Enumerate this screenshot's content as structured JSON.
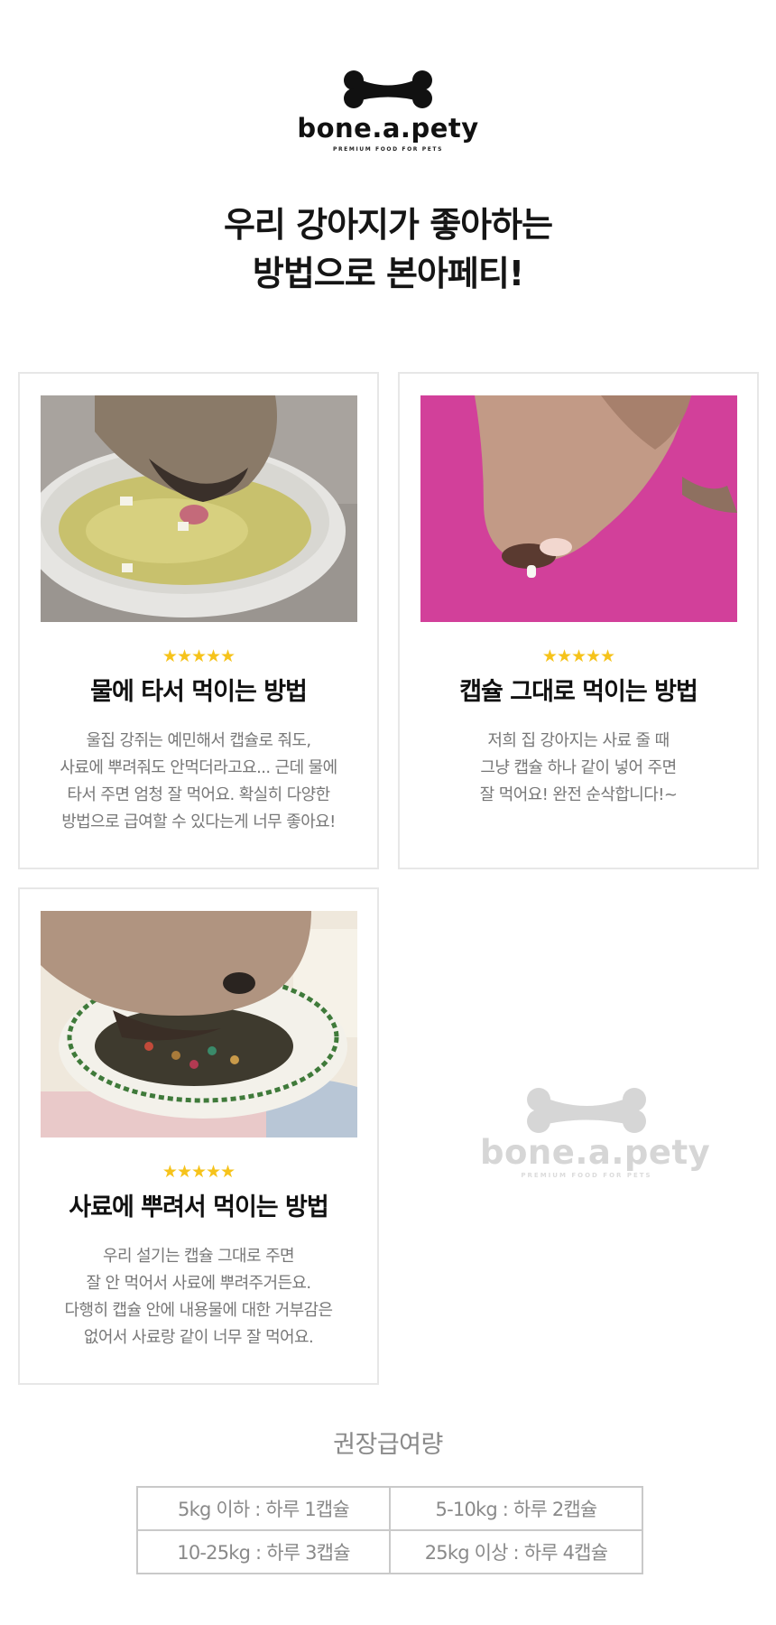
{
  "brand": {
    "name": "bone.a.pety",
    "tagline": "PREMIUM FOOD FOR PETS",
    "logo_icon": "bone-icon"
  },
  "headline": {
    "line1": "우리 강아지가 좋아하는",
    "line2": "방법으로 본아페티!"
  },
  "cards": [
    {
      "stars": "★★★★★",
      "rating": 5,
      "title": "물에 타서 먹이는 방법",
      "description": "울집 강쥐는 예민해서 캡슐로 줘도,\n사료에 뿌려줘도 안먹더라고요... 근데 물에\n타서 주면 엄청 잘 먹어요. 확실히 다양한\n방법으로 급여할 수 있다는게 너무 좋아요!"
    },
    {
      "stars": "★★★★★",
      "rating": 5,
      "title": "캡슐 그대로 먹이는 방법",
      "description": "저희 집 강아지는 사료 줄 때\n그냥 캡슐 하나 같이 넣어 주면\n잘 먹어요! 완전 순삭합니다!~"
    },
    {
      "stars": "★★★★★",
      "rating": 5,
      "title": "사료에 뿌려서 먹이는 방법",
      "description": "우리 설기는 캡슐 그대로 주면\n잘 안 먹어서 사료에 뿌려주거든요.\n다행히 캡슐 안에 내용물에 대한 거부감은\n없어서 사료랑 같이 너무 잘 먹어요."
    }
  ],
  "dosage": {
    "title": "권장급여량",
    "rows": [
      [
        "5kg 이하 : 하루 1캡슐",
        "5-10kg : 하루 2캡슐"
      ],
      [
        "10-25kg : 하루 3캡슐",
        "25kg 이상 : 하루 4캡슐"
      ]
    ]
  },
  "colors": {
    "star": "#f6c31b",
    "card_border": "#e7e7e7",
    "body_text": "#777777",
    "watermark": "#d6d6d6"
  }
}
